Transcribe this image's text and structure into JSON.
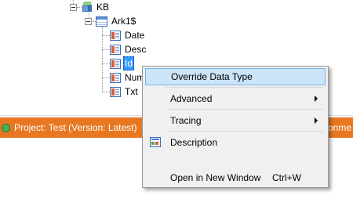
{
  "tree": {
    "kb_label": "KB",
    "table_label": "Ark1$",
    "columns": [
      "Date",
      "Desc",
      "Id",
      "Num",
      "Txt"
    ],
    "selected_column": "Id"
  },
  "status_bar": {
    "project_text": "Project: Test (Version: Latest)",
    "right_text": "ronme"
  },
  "context_menu": {
    "items": [
      {
        "label": "Override Data Type",
        "highlighted": true
      },
      {
        "label": "Advanced",
        "submenu": true
      },
      {
        "label": "Tracing",
        "submenu": true
      },
      {
        "label": "Description",
        "icon": "description-icon"
      },
      {
        "label": "Open in New Window",
        "shortcut": "Ctrl+W"
      }
    ]
  },
  "colors": {
    "status_bar": "#e87722",
    "highlight_bg": "#cce4f7",
    "selection": "#3399ff"
  }
}
